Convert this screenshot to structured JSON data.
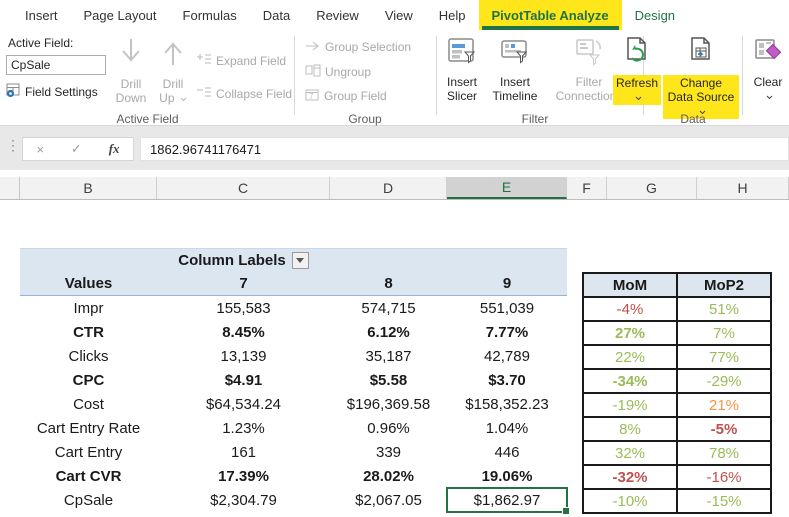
{
  "colors": {
    "excel_green": "#217346",
    "highlight_yellow": "#ffe61a",
    "green": "#9bbb59",
    "red": "#c0504d",
    "orange": "#f79646",
    "header_blue": "#dce6f1",
    "pivot_border": "#95b3d7"
  },
  "tabs": [
    {
      "label": "Insert"
    },
    {
      "label": "Page Layout"
    },
    {
      "label": "Formulas"
    },
    {
      "label": "Data"
    },
    {
      "label": "Review"
    },
    {
      "label": "View"
    },
    {
      "label": "Help"
    },
    {
      "label": "PivotTable Analyze",
      "active": true,
      "highlighted": true
    },
    {
      "label": "Design",
      "contextual": true
    }
  ],
  "ribbon": {
    "active_field_group": {
      "label": "Active Field:",
      "field_value": "CpSale",
      "field_settings": "Field Settings",
      "drill_down": "Drill Down",
      "drill_up": "Drill Up",
      "expand_field": "Expand Field",
      "collapse_field": "Collapse Field",
      "group_label": "Active Field"
    },
    "group_group": {
      "group_selection": "Group Selection",
      "ungroup": "Ungroup",
      "group_field": "Group Field",
      "group_label": "Group"
    },
    "filter_group": {
      "insert_slicer": "Insert Slicer",
      "insert_timeline": "Insert Timeline",
      "filter_connections": "Filter Connections",
      "group_label": "Filter"
    },
    "data_group": {
      "refresh": "Refresh",
      "change_data_source": "Change Data Source",
      "group_label": "Data"
    },
    "clear": "Clear"
  },
  "formula_bar": {
    "fx": "fx",
    "cancel": "×",
    "enter": "✓",
    "value": "1862.96741176471"
  },
  "sheet": {
    "column_headers": [
      "B",
      "C",
      "D",
      "E",
      "F",
      "G",
      "H"
    ],
    "selected_column": "E"
  },
  "pivot": {
    "column_labels": "Column Labels",
    "values_label": "Values",
    "columns": [
      "7",
      "8",
      "9"
    ],
    "rows": [
      {
        "label": "Impr",
        "bold": false,
        "values": [
          "155,583",
          "574,715",
          "551,039"
        ]
      },
      {
        "label": "CTR",
        "bold": true,
        "values": [
          "8.45%",
          "6.12%",
          "7.77%"
        ]
      },
      {
        "label": "Clicks",
        "bold": false,
        "values": [
          "13,139",
          "35,187",
          "42,789"
        ]
      },
      {
        "label": "CPC",
        "bold": true,
        "values": [
          "$4.91",
          "$5.58",
          "$3.70"
        ]
      },
      {
        "label": "Cost",
        "bold": false,
        "values": [
          "$64,534.24",
          "$196,369.58",
          "$158,352.23"
        ]
      },
      {
        "label": "Cart Entry Rate",
        "bold": false,
        "values": [
          "1.23%",
          "0.96%",
          "1.04%"
        ]
      },
      {
        "label": "Cart Entry",
        "bold": false,
        "values": [
          "161",
          "339",
          "446"
        ]
      },
      {
        "label": "Cart CVR",
        "bold": true,
        "values": [
          "17.39%",
          "28.02%",
          "19.06%"
        ]
      },
      {
        "label": "CpSale",
        "bold": false,
        "values": [
          "$2,304.79",
          "$2,067.05",
          "$1,862.97"
        ]
      }
    ],
    "selected_cell": {
      "row": 8,
      "col": 2
    }
  },
  "comparison": {
    "headers": [
      "MoM",
      "MoP2"
    ],
    "rows": [
      [
        {
          "text": "-4%",
          "color": "red"
        },
        {
          "text": "51%",
          "color": "green"
        }
      ],
      [
        {
          "text": "27%",
          "color": "green",
          "bold": true
        },
        {
          "text": "7%",
          "color": "green"
        }
      ],
      [
        {
          "text": "22%",
          "color": "green"
        },
        {
          "text": "77%",
          "color": "green"
        }
      ],
      [
        {
          "text": "-34%",
          "color": "green",
          "bold": true
        },
        {
          "text": "-29%",
          "color": "green"
        }
      ],
      [
        {
          "text": "-19%",
          "color": "green"
        },
        {
          "text": "21%",
          "color": "orange"
        }
      ],
      [
        {
          "text": "8%",
          "color": "green"
        },
        {
          "text": "-5%",
          "color": "red",
          "bold": true
        }
      ],
      [
        {
          "text": "32%",
          "color": "green"
        },
        {
          "text": "78%",
          "color": "green"
        }
      ],
      [
        {
          "text": "-32%",
          "color": "red",
          "bold": true
        },
        {
          "text": "-16%",
          "color": "red"
        }
      ],
      [
        {
          "text": "-10%",
          "color": "green"
        },
        {
          "text": "-15%",
          "color": "green"
        }
      ]
    ]
  },
  "icons": [
    "field-settings-icon",
    "drill-down-icon",
    "drill-up-icon",
    "expand-field-icon",
    "collapse-field-icon",
    "group-selection-icon",
    "ungroup-icon",
    "group-field-icon",
    "insert-slicer-icon",
    "insert-timeline-icon",
    "filter-connections-icon",
    "refresh-icon",
    "change-data-source-icon",
    "clear-icon",
    "cancel-icon",
    "enter-icon",
    "fx-icon",
    "column-labels-dropdown-icon",
    "fill-handle"
  ]
}
